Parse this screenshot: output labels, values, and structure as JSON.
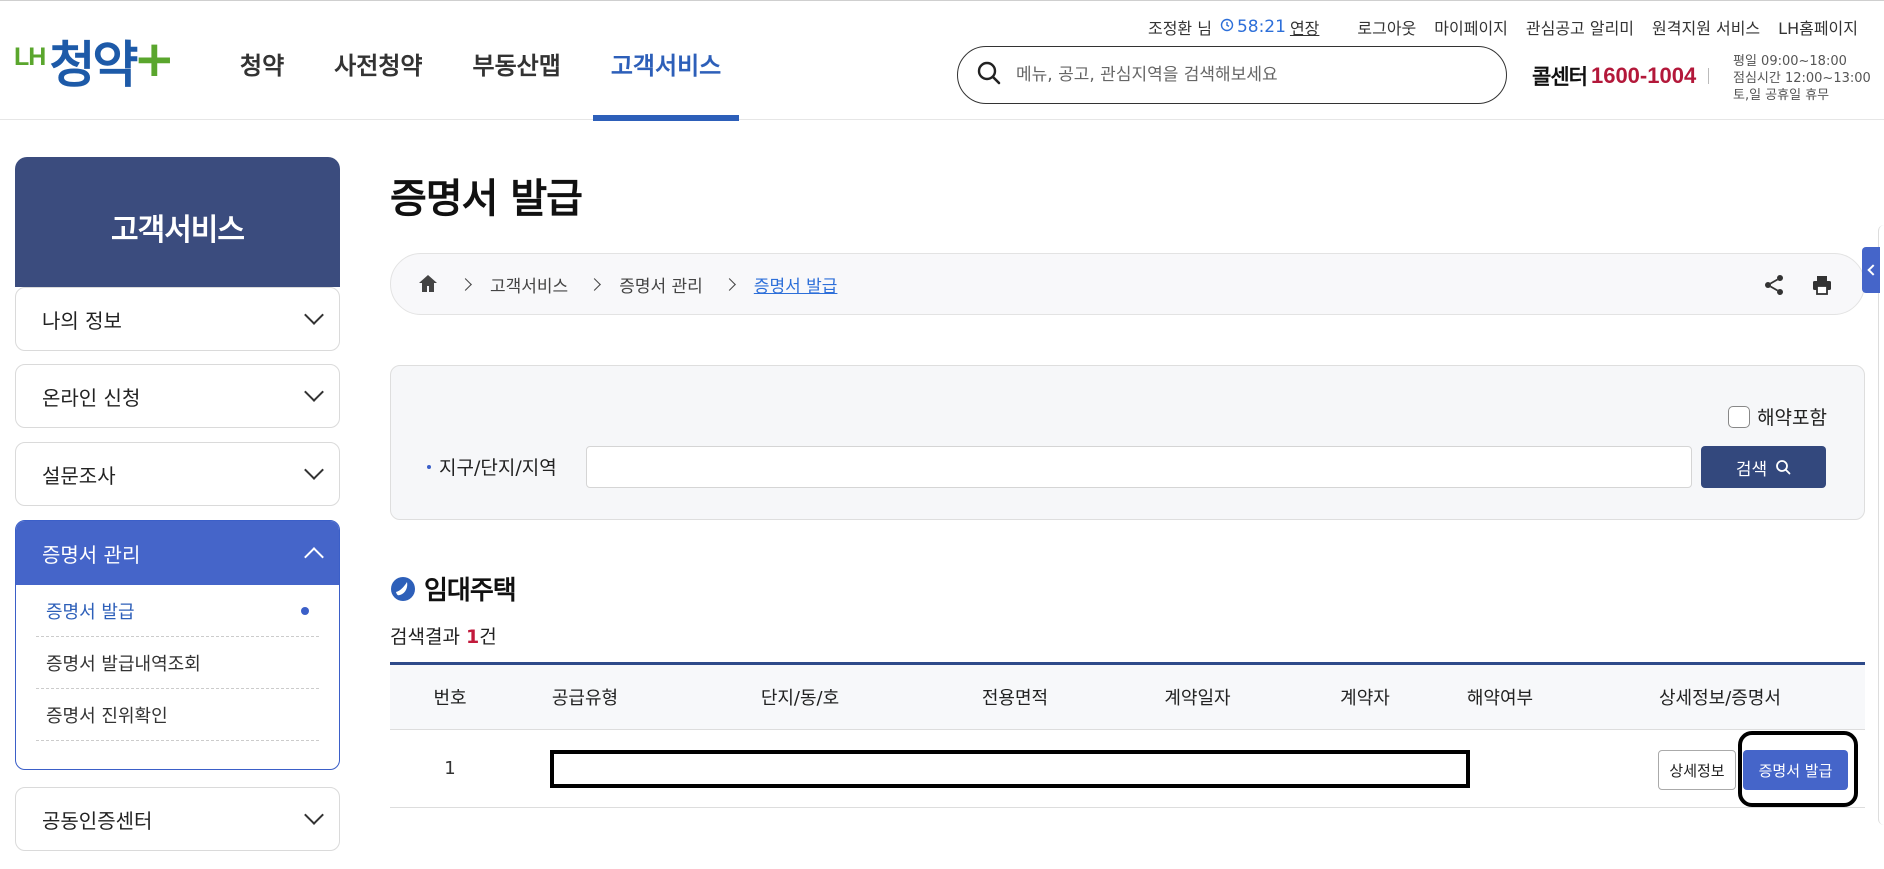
{
  "header": {
    "logo": {
      "prefix": "LH",
      "main": "청약",
      "plus": "+"
    },
    "nav": [
      "청약",
      "사전청약",
      "부동산맵",
      "고객서비스"
    ],
    "active_nav": "고객서비스",
    "util": {
      "user": "조정환 님",
      "timer": "58:21",
      "extend": "연장",
      "links": [
        "로그아웃",
        "마이페이지",
        "관심공고 알리미",
        "원격지원 서비스",
        "LH홈페이지"
      ]
    },
    "search": {
      "placeholder": "메뉴, 공고, 관심지역을 검색해보세요"
    },
    "callcenter": {
      "label": "콜센터",
      "number": "1600-1004",
      "hours": [
        "평일 09:00~18:00",
        "점심시간 12:00~13:00",
        "토,일 공휴일 휴무"
      ]
    }
  },
  "sidebar": {
    "title": "고객서비스",
    "menus": [
      "나의 정보",
      "온라인 신청",
      "설문조사"
    ],
    "group": {
      "label": "증명서 관리",
      "items": [
        "증명서 발급",
        "증명서 발급내역조회",
        "증명서 진위확인"
      ]
    },
    "last_menu": "공동인증센터"
  },
  "main": {
    "title": "증명서 발급",
    "breadcrumb": [
      "고객서비스",
      "증명서 관리",
      "증명서 발급"
    ],
    "filter": {
      "checkbox_label": "해약포함",
      "field_label": "지구/단지/지역",
      "field_value": "",
      "search_label": "검색"
    },
    "section_title": "임대주택",
    "result": {
      "prefix": "검색결과 ",
      "count": "1",
      "suffix": "건"
    },
    "table": {
      "headers": [
        "번호",
        "공급유형",
        "단지/동/호",
        "전용면적",
        "계약일자",
        "계약자",
        "해약여부",
        "상세정보/증명서"
      ],
      "rows": [
        {
          "no": "1",
          "detail_label": "상세정보",
          "issue_label": "증명서 발급"
        }
      ]
    }
  },
  "colors": {
    "brand_blue": "#2d5fb9",
    "brand_green": "#5aa62d",
    "navy": "#3b4c7e",
    "accent_red": "#b3183a"
  }
}
